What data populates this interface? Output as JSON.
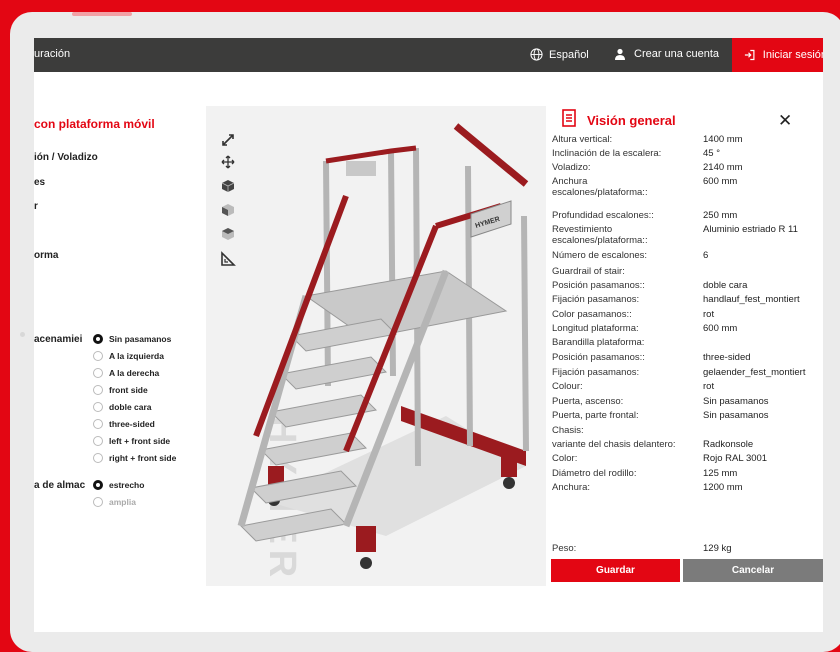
{
  "topbar": {
    "crumb": "uración",
    "language": "Español",
    "create_account": "Crear una cuenta",
    "login": "Iniciar sesión"
  },
  "config": {
    "title": "con plataforma móvil",
    "labels": [
      "ión / Voladizo",
      "es",
      "r",
      "orma",
      "acenamiei",
      "a de almac"
    ],
    "handrail_options": [
      {
        "label": "Sin pasamanos",
        "selected": true
      },
      {
        "label": "A la izquierda",
        "selected": false
      },
      {
        "label": "A la derecha",
        "selected": false
      },
      {
        "label": "front side",
        "selected": false
      },
      {
        "label": "doble cara",
        "selected": false
      },
      {
        "label": "three-sided",
        "selected": false
      },
      {
        "label": "left + front side",
        "selected": false
      },
      {
        "label": "right + front side",
        "selected": false
      }
    ],
    "storage_options": [
      {
        "label": "estrecho",
        "selected": true
      },
      {
        "label": "amplia",
        "selected": false
      }
    ]
  },
  "viewer": {
    "tools": [
      "expand-icon",
      "move-icon",
      "cube-icon",
      "cube-side-icon",
      "cube-top-icon",
      "measure-icon"
    ],
    "watermark": "HYMER",
    "brand_plate": "HYMER"
  },
  "overview": {
    "title": "Visión general",
    "rows": [
      {
        "k": "Altura vertical:",
        "v": "1400 mm"
      },
      {
        "k": "Inclinación de la escalera:",
        "v": "45 °"
      },
      {
        "k": "Voladizo:",
        "v": "2140 mm"
      },
      {
        "k": "Anchura escalones/plataforma::",
        "v": "600 mm"
      },
      {
        "k": "Profundidad escalones::",
        "v": "250 mm"
      },
      {
        "k": "Revestimiento escalones/plataforma::",
        "v": "Aluminio estriado R 11"
      },
      {
        "k": "Número de escalones:",
        "v": "6"
      },
      {
        "k": "Guardrail of stair:",
        "v": ""
      },
      {
        "k": "Posición pasamanos::",
        "v": "doble cara"
      },
      {
        "k": "Fijación pasamanos:",
        "v": "handlauf_fest_montiert"
      },
      {
        "k": "Color pasamanos::",
        "v": "rot"
      },
      {
        "k": "Longitud plataforma:",
        "v": "600 mm"
      },
      {
        "k": "Barandilla plataforma:",
        "v": ""
      },
      {
        "k": "Posición pasamanos::",
        "v": "three-sided"
      },
      {
        "k": "Fijación pasamanos:",
        "v": "gelaender_fest_montiert"
      },
      {
        "k": "Colour:",
        "v": "rot"
      },
      {
        "k": "Puerta, ascenso:",
        "v": "Sin pasamanos"
      },
      {
        "k": "Puerta, parte frontal:",
        "v": "Sin pasamanos"
      },
      {
        "k": "Chasis:",
        "v": ""
      },
      {
        "k": "variante del chasis delantero:",
        "v": "Radkonsole"
      },
      {
        "k": "Color:",
        "v": "Rojo RAL 3001"
      },
      {
        "k": "Diámetro del rodillo:",
        "v": "125 mm"
      },
      {
        "k": "Anchura:",
        "v": "1200 mm"
      }
    ],
    "weight": {
      "k": "Peso:",
      "v": "129 kg"
    },
    "save": "Guardar",
    "cancel": "Cancelar"
  },
  "colors": {
    "brand_red": "#e30613",
    "topbar": "#3c3c3b",
    "cancel": "#7b7b7b"
  }
}
